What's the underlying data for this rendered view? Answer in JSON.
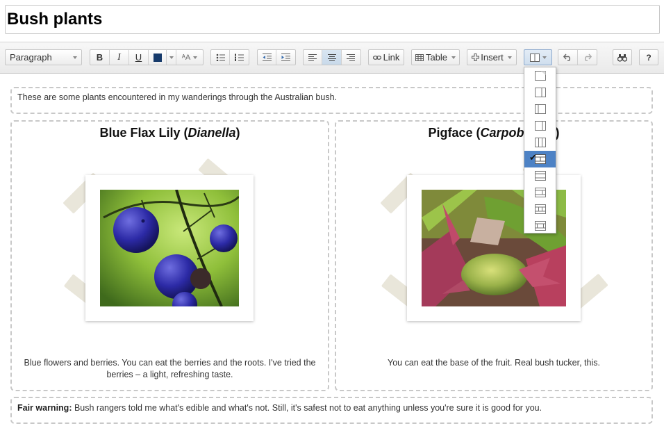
{
  "document": {
    "title": "Bush plants"
  },
  "toolbar": {
    "format_select": "Paragraph",
    "bold_label": "B",
    "italic_label": "I",
    "underline_label": "U",
    "text_color": "#163a6b",
    "font_size_label": "ᴬA",
    "link_label": "Link",
    "table_label": "Table",
    "insert_label": "Insert",
    "icons": [
      "bullet-list-icon",
      "numbered-list-icon",
      "outdent-icon",
      "indent-icon",
      "align-left-icon",
      "align-center-icon",
      "align-right-icon",
      "link-icon",
      "table-icon",
      "insert-plus-icon",
      "layout-icon",
      "undo-icon",
      "redo-icon",
      "find-icon",
      "help-icon"
    ],
    "help_label": "?"
  },
  "content": {
    "intro": "These are some plants encountered in my wanderings through the Australian bush.",
    "left": {
      "title_prefix": "Blue Flax Lily (",
      "title_italic": "Dianella",
      "title_suffix": ")",
      "caption": "Blue flowers and berries. You can eat the berries and the roots. I've tried the berries – a light, refreshing taste."
    },
    "right": {
      "title_prefix": "Pigface (",
      "title_italic": "Carpobrotus",
      "title_suffix": ")",
      "caption": "You can eat the base of the fruit. Real bush tucker, this."
    },
    "warning_bold": "Fair warning:",
    "warning_text": " Bush rangers told me what's edible and what's not. Still, it's safest not to eat anything unless you're sure it is good for you."
  },
  "layout_menu": {
    "selected_index": 5,
    "check_mark": "✔",
    "accent": "#4d82c5"
  }
}
